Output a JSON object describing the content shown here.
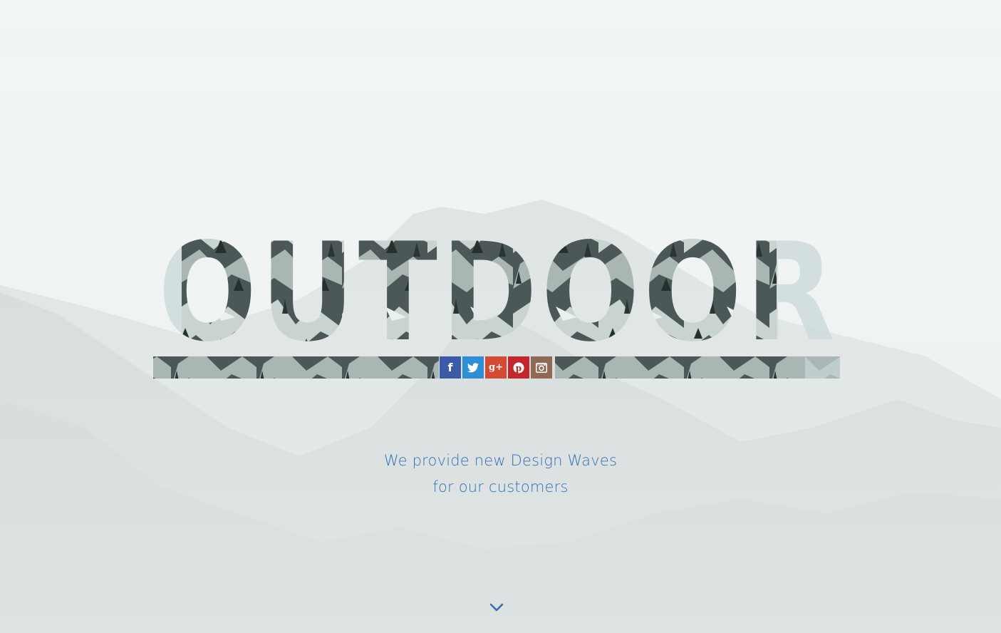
{
  "hero": {
    "title": "OUTDOOR",
    "tagline_line1": "We provide new Design Waves",
    "tagline_line2": "for our customers"
  },
  "social": [
    {
      "name": "facebook",
      "glyph": "f",
      "color": "#3b5ba8"
    },
    {
      "name": "twitter",
      "glyph": "twitter-bird",
      "color": "#2f8fd6"
    },
    {
      "name": "google-plus",
      "glyph": "g+",
      "color": "#d44a32"
    },
    {
      "name": "pinterest",
      "glyph": "P",
      "color": "#c3262c"
    },
    {
      "name": "instagram",
      "glyph": "camera",
      "color": "#8e6a54"
    }
  ],
  "colors": {
    "accent": "#3570b6",
    "sky": "#eef3f2",
    "mountain_dark": "#3d4a4a",
    "snow": "#e6ecec"
  },
  "icons": {
    "scroll": "chevron-down-icon"
  }
}
